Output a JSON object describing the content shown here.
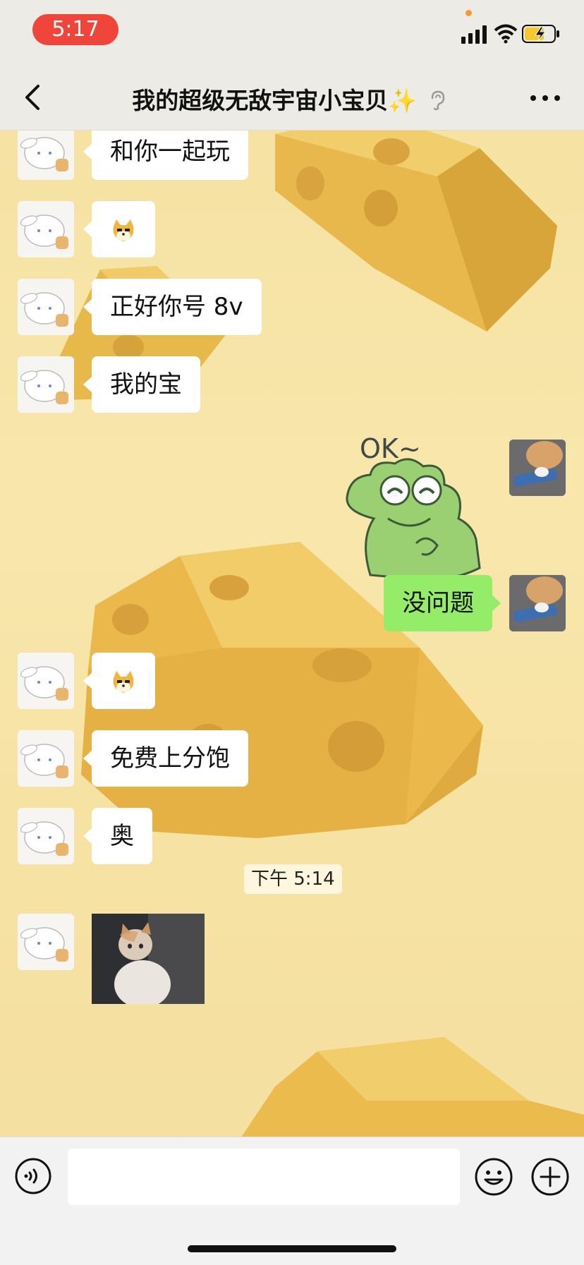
{
  "status_bar": {
    "time": "5:17",
    "time_pill_color": "#f0453b",
    "icons": [
      "signal-icon",
      "wifi-icon",
      "battery-charging-icon"
    ]
  },
  "header": {
    "title": "我的超级无敌宇宙小宝贝✨",
    "back_icon": "chevron-left-icon",
    "ear_icon": "ear-icon",
    "more_icon": "more-horizontal-icon"
  },
  "chat": {
    "background": "cheese-wallpaper",
    "accent_bubble_color": "#95ec69",
    "messages": [
      {
        "side": "left",
        "type": "text",
        "text": "和你一起玩"
      },
      {
        "side": "left",
        "type": "emoji",
        "emoji": "doge-emoji"
      },
      {
        "side": "left",
        "type": "text",
        "text": "正好你号 8v"
      },
      {
        "side": "left",
        "type": "text",
        "text": "我的宝"
      },
      {
        "side": "right",
        "type": "sticker",
        "sticker_text": "OK~"
      },
      {
        "side": "right",
        "type": "text",
        "text": "没问题"
      },
      {
        "side": "left",
        "type": "emoji",
        "emoji": "doge-emoji"
      },
      {
        "side": "left",
        "type": "text",
        "text": "免费上分饱"
      },
      {
        "side": "left",
        "type": "text",
        "text": "奥"
      },
      {
        "side": "center",
        "type": "timestamp",
        "text": "下午 5:14"
      },
      {
        "side": "left",
        "type": "image",
        "image": "kitten-photo"
      }
    ]
  },
  "input_bar": {
    "voice_icon": "voice-icon",
    "input_value": "",
    "emoji_icon": "smiley-icon",
    "plus_icon": "plus-icon"
  }
}
